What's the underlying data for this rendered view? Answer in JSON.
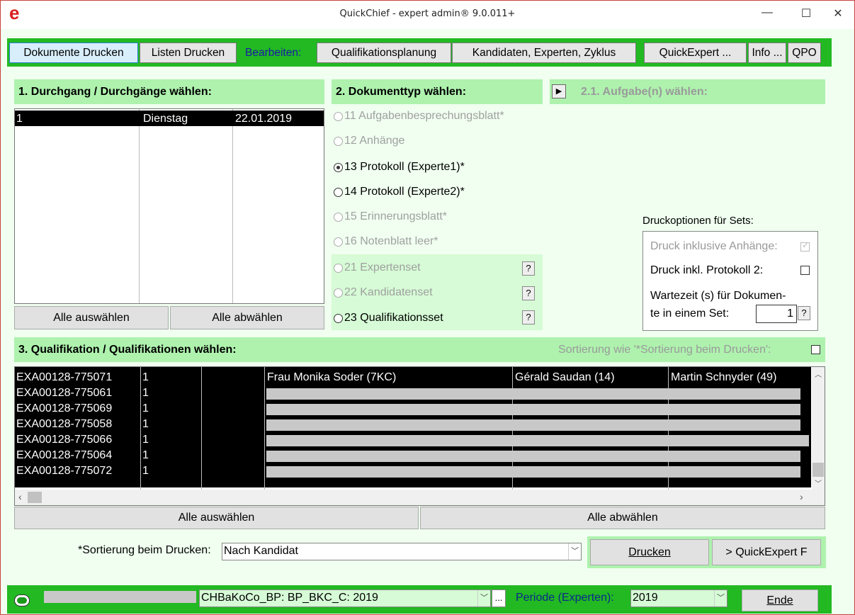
{
  "window": {
    "title": "QuickChief - expert admin® 9.0.011+",
    "logo": "e",
    "min": "—",
    "max": "☐",
    "close": "✕"
  },
  "toolbar": {
    "dokumente_drucken": "Dokumente Drucken",
    "listen_drucken": "Listen Drucken",
    "bearbeiten": "Bearbeiten:",
    "qualifikationsplanung": "Qualifikationsplanung",
    "kandidaten": "Kandidaten, Experten, Zyklus",
    "quickexpert": "QuickExpert ...",
    "info": "Info ...",
    "qpo": "QPO"
  },
  "section1": {
    "title": "1. Durchgang / Durchgänge  wählen:",
    "rows": [
      {
        "c1": "1",
        "c2": "Dienstag",
        "c3": "22.01.2019"
      }
    ],
    "select_all": "Alle auswählen",
    "deselect_all": "Alle abwählen"
  },
  "section2": {
    "title": "2. Dokumenttyp wählen:",
    "options": [
      {
        "label": "11 Aufgabenbesprechungsblatt*",
        "state": "disabled"
      },
      {
        "label": "12 Anhänge",
        "state": "disabled"
      },
      {
        "label": "13 Protokoll (Experte1)*",
        "state": "selected"
      },
      {
        "label": "14 Protokoll (Experte2)*",
        "state": "enabled"
      },
      {
        "label": "15 Erinnerungsblatt*",
        "state": "disabled"
      },
      {
        "label": "16 Notenblatt leer*",
        "state": "disabled"
      },
      {
        "label": "21 Expertenset",
        "state": "disabled"
      },
      {
        "label": "22 Kandidatenset",
        "state": "disabled"
      },
      {
        "label": "23 Qualifikationsset",
        "state": "enabled"
      }
    ],
    "help": "?"
  },
  "section21": {
    "arrow": "▶",
    "title": "2.1. Aufgabe(n) wählen:"
  },
  "druckoptionen": {
    "title": "Druckoptionen für Sets:",
    "inkl_anhaenge": "Druck inklusive Anhänge:",
    "inkl_protokoll2": "Druck inkl. Protokoll 2:",
    "wartezeit_line1": "Wartezeit (s)  für Dokumen-",
    "wartezeit_line2": "te in einem Set:",
    "wartezeit_value": "1",
    "help": "?"
  },
  "section3": {
    "title": "3. Qualifikation / Qualifikationen wählen:",
    "sort_label": "Sortierung wie '*Sortierung beim Drucken':",
    "rows": [
      {
        "id": "EXA00128-775071",
        "n": "1",
        "name": "Frau Monika Soder (7KC)",
        "e1": "Gérald Saudan (14)",
        "e2": "Martin Schnyder (49)"
      },
      {
        "id": "EXA00128-775061",
        "n": "1",
        "name": "",
        "e1": "",
        "e2": ""
      },
      {
        "id": "EXA00128-775069",
        "n": "1",
        "name": "",
        "e1": "",
        "e2": ""
      },
      {
        "id": "EXA00128-775058",
        "n": "1",
        "name": "",
        "e1": "",
        "e2": ""
      },
      {
        "id": "EXA00128-775066",
        "n": "1",
        "name": "",
        "e1": "",
        "e2": ""
      },
      {
        "id": "EXA00128-775064",
        "n": "1",
        "name": "",
        "e1": "",
        "e2": ""
      },
      {
        "id": "EXA00128-775072",
        "n": "1",
        "name": "",
        "e1": "",
        "e2": ""
      }
    ],
    "select_all": "Alle auswählen",
    "deselect_all": "Alle abwählen"
  },
  "bottom": {
    "sort_label": "*Sortierung beim Drucken:",
    "sort_value": "Nach Kandidat",
    "drucken": "Drucken",
    "quickexpert_f": "> QuickExpert F"
  },
  "statusbar": {
    "profile_value": "CHBaKoCo_BP: BP_BKC_C: 2019",
    "ellipsis": "...",
    "periode_label": "Periode (Experten):",
    "periode_value": "2019",
    "ende": "Ende"
  }
}
